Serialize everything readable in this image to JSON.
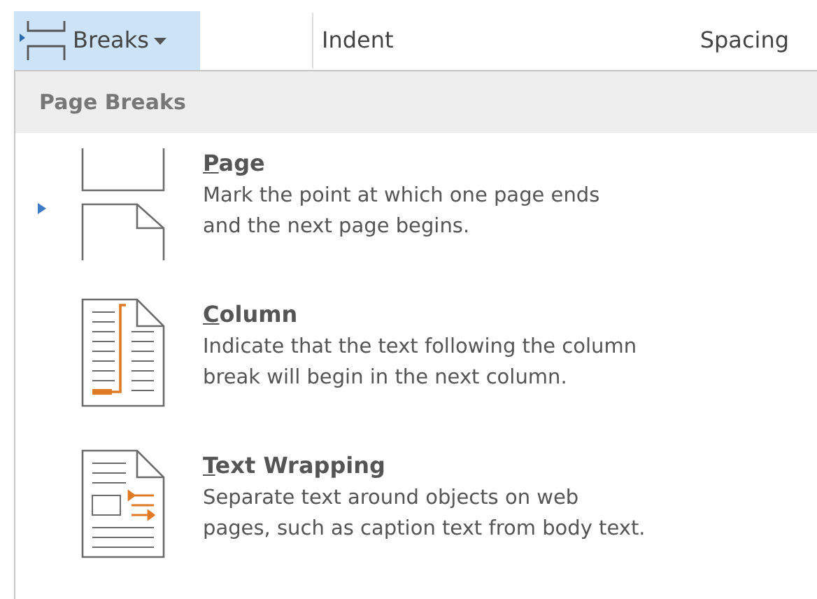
{
  "toolbar": {
    "breaks_button": {
      "label": "Breaks",
      "expanded": true
    },
    "labels": [
      "Indent",
      "Spacing"
    ]
  },
  "menu": {
    "header": "Page Breaks",
    "items": [
      {
        "kind": "page",
        "title_key": "P",
        "title_rest": "age",
        "description_lines": [
          "Mark the point at which one page ends",
          "and the next page begins."
        ],
        "selected": true
      },
      {
        "kind": "column",
        "title_key": "C",
        "title_rest": "olumn",
        "description_lines": [
          "Indicate that the text following the column",
          "break will begin in the next column."
        ],
        "selected": false
      },
      {
        "kind": "wrapping",
        "title_key": "T",
        "title_rest": "ext Wrapping",
        "description_lines": [
          "Separate text around objects on web",
          "pages, such as caption text from body text."
        ],
        "selected": false
      }
    ]
  }
}
